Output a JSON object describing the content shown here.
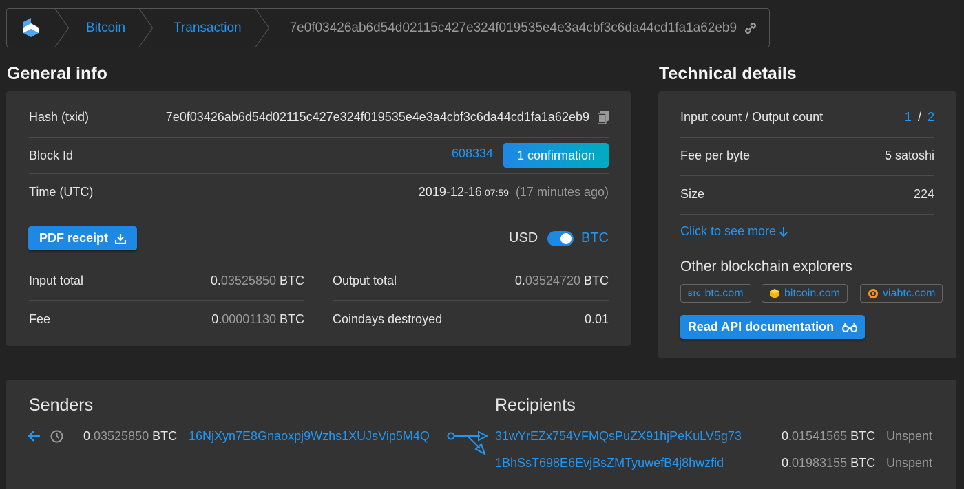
{
  "breadcrumb": {
    "items": [
      "Bitcoin",
      "Transaction"
    ],
    "current": "7e0f03426ab6d54d02115c427e324f019535e4e3a4cbf3c6da44cd1fa1a62eb9"
  },
  "general": {
    "title": "General info",
    "hash_label": "Hash (txid)",
    "hash_value": "7e0f03426ab6d54d02115c427e324f019535e4e3a4cbf3c6da44cd1fa1a62eb9",
    "block_label": "Block Id",
    "block_value": "608334",
    "confirmation": "1 confirmation",
    "time_label": "Time (UTC)",
    "time_date": "2019-12-16",
    "time_clock": "07:59",
    "time_ago": "(17 minutes ago)",
    "pdf_button": "PDF receipt",
    "currency_left": "USD",
    "currency_right": "BTC",
    "input_total_label": "Input total",
    "input_total_int": "0.",
    "input_total_frac": "03525850",
    "input_total_unit": "BTC",
    "output_total_label": "Output total",
    "output_total_int": "0.",
    "output_total_frac": "03524720",
    "output_total_unit": "BTC",
    "fee_label": "Fee",
    "fee_int": "0.",
    "fee_frac": "00001130",
    "fee_unit": "BTC",
    "coindays_label": "Coindays destroyed",
    "coindays_value": "0.01"
  },
  "technical": {
    "title": "Technical details",
    "io_label": "Input count / Output count",
    "input_count": "1",
    "io_sep": "/",
    "output_count": "2",
    "fee_byte_label": "Fee per byte",
    "fee_byte_value": "5 satoshi",
    "size_label": "Size",
    "size_value": "224",
    "see_more": "Click to see more",
    "explorers_title": "Other blockchain explorers",
    "explorers": [
      "btc.com",
      "bitcoin.com",
      "viabtc.com"
    ],
    "btc_icon_text": "BTC",
    "api_button": "Read API documentation"
  },
  "flow": {
    "senders_title": "Senders",
    "recipients_title": "Recipients",
    "sender": {
      "amount_int": "0.",
      "amount_frac": "03525850",
      "unit": "BTC",
      "address": "16NjXyn7E8Gnaoxpj9Wzhs1XUJsVip5M4Q"
    },
    "recipients": [
      {
        "address": "31wYrEZx754VFMQsPuZX91hjPeKuLV5g73",
        "amount_int": "0.",
        "amount_frac": "01541565",
        "unit": "BTC",
        "status": "Unspent"
      },
      {
        "address": "1BhSsT698E6EvjBsZMTyuwefB4j8hwzfid",
        "amount_int": "0.",
        "amount_frac": "01983155",
        "unit": "BTC",
        "status": "Unspent"
      }
    ]
  },
  "colors": {
    "accent": "#2196f3",
    "button": "#1e88e5",
    "card": "#333333",
    "bg": "#232323"
  }
}
